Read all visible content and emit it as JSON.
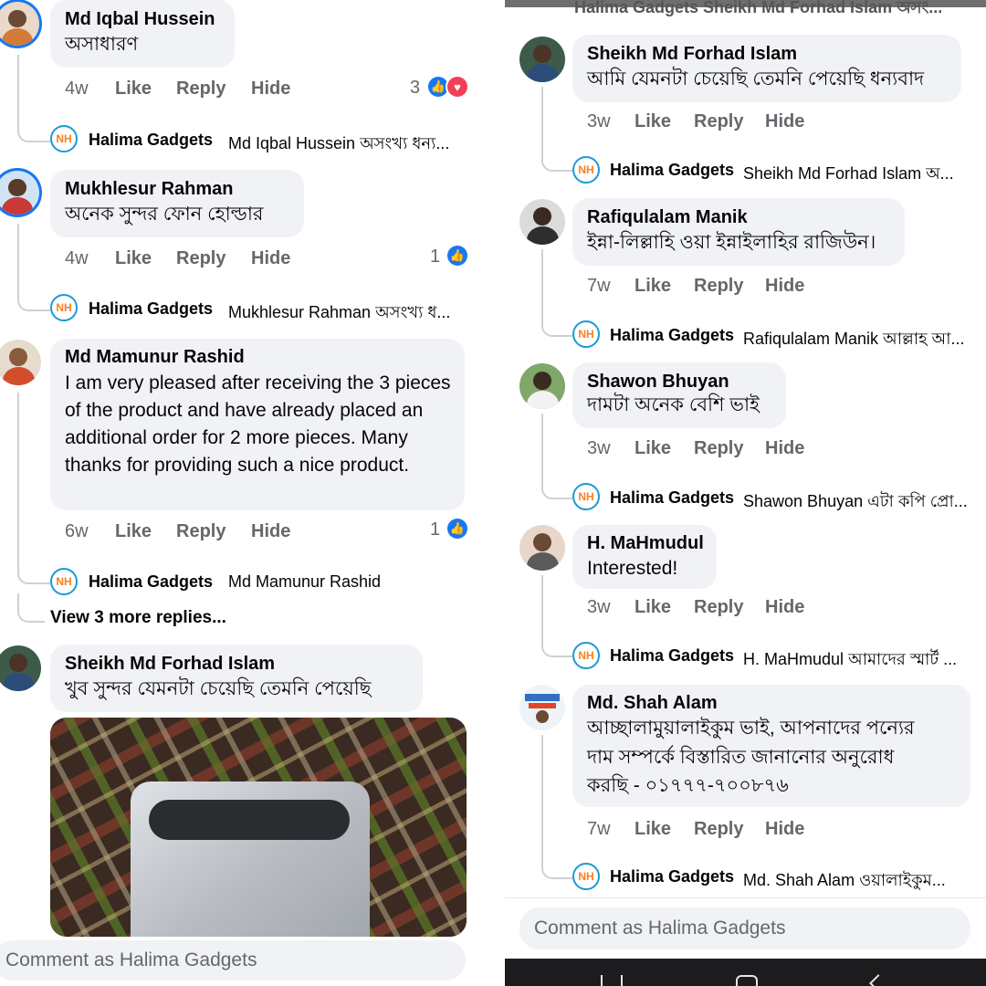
{
  "left": {
    "comments": [
      {
        "author": "Md Iqbal Hussein",
        "text": "অসাধারণ",
        "time": "4w",
        "like": "Like",
        "reply": "Reply",
        "hide": "Hide",
        "reaction_count": "3",
        "reply_preview": {
          "name": "Halima Gadgets",
          "text": "Md Iqbal Hussein অসংখ্য ধন্য..."
        }
      },
      {
        "author": "Mukhlesur Rahman",
        "text": "অনেক সুন্দর ফোন হোল্ডার",
        "time": "4w",
        "like": "Like",
        "reply": "Reply",
        "hide": "Hide",
        "reaction_count": "1",
        "reply_preview": {
          "name": "Halima Gadgets",
          "text": "Mukhlesur Rahman অসংখ্য ধ..."
        }
      },
      {
        "author": "Md Mamunur Rashid",
        "text": "I am very pleased after receiving the 3 pieces of the product and have already placed an additional order for 2 more pieces. Many thanks for providing such a nice product.",
        "time": "6w",
        "like": "Like",
        "reply": "Reply",
        "hide": "Hide",
        "reaction_count": "1",
        "reply_preview": {
          "name": "Halima Gadgets",
          "text": "Md Mamunur Rashid"
        },
        "view_more": "View 3 more replies..."
      },
      {
        "author": "Sheikh Md Forhad Islam",
        "text": "খুব সুন্দর যেমনটা চেয়েছি তেমনি পেয়েছি"
      }
    ],
    "composer_placeholder": "Comment as Halima Gadgets"
  },
  "right": {
    "top_cut_text": "Halima Gadgets Sheikh Md Forhad Islam অসং...",
    "comments": [
      {
        "author": "Sheikh Md Forhad Islam",
        "text": "আমি যেমনটা চেয়েছি তেমনি পেয়েছি ধন্যবাদ",
        "time": "3w",
        "like": "Like",
        "reply": "Reply",
        "hide": "Hide",
        "reply_preview": {
          "name": "Halima Gadgets",
          "text": "Sheikh Md Forhad Islam অ..."
        }
      },
      {
        "author": "Rafiqulalam Manik",
        "text": "ইন্না-লিল্লাহি ওয়া ইন্নাইলাহির রাজিউন।",
        "time": "7w",
        "like": "Like",
        "reply": "Reply",
        "hide": "Hide",
        "reply_preview": {
          "name": "Halima Gadgets",
          "text": "Rafiqulalam Manik আল্লাহ আ..."
        }
      },
      {
        "author": "Shawon Bhuyan",
        "text": "দামটা অনেক বেশি ভাই",
        "time": "3w",
        "like": "Like",
        "reply": "Reply",
        "hide": "Hide",
        "reply_preview": {
          "name": "Halima Gadgets",
          "text": "Shawon Bhuyan এটা কপি প্রো..."
        }
      },
      {
        "author": "H. MaHmudul",
        "text": "Interested!",
        "time": "3w",
        "like": "Like",
        "reply": "Reply",
        "hide": "Hide",
        "reply_preview": {
          "name": "Halima Gadgets",
          "text": "H. MaHmudul আমাদের স্মার্ট ..."
        }
      },
      {
        "author": "Md. Shah Alam",
        "text_lines": [
          "আচ্ছালামুয়ালাইকুম ভাই, আপনাদের পন্যের",
          "দাম সম্পর্কে বিস্তারিত জানানোর অনুরোধ",
          "করছি - ০১৭৭৭-৭০০৮৭৬"
        ],
        "time": "7w",
        "like": "Like",
        "reply": "Reply",
        "hide": "Hide",
        "reply_preview": {
          "name": "Halima Gadgets",
          "text": "Md. Shah Alam ওয়ালাইকুম..."
        }
      }
    ],
    "composer_placeholder": "Comment as Halima Gadgets"
  },
  "icons": {
    "like": "like-icon",
    "love": "love-icon",
    "page_avatar_letters": "NH"
  },
  "colors": {
    "bubble": "#f0f2f5",
    "meta": "#65676b",
    "like_blue": "#1877f2",
    "love_red": "#f33e58",
    "nav_bar": "#1c1c1e"
  }
}
